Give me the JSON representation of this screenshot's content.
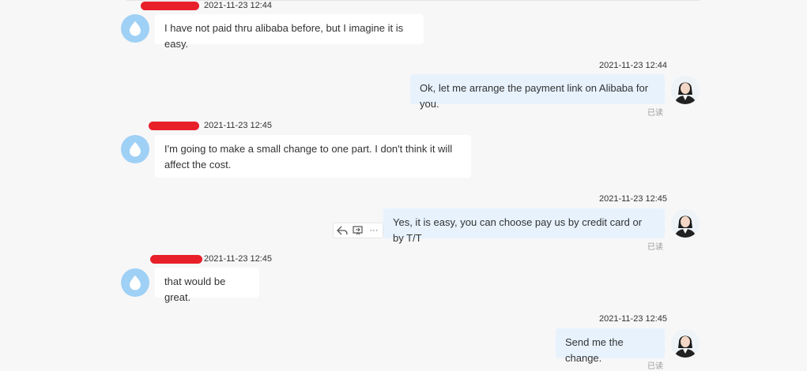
{
  "messages": [
    {
      "side": "left",
      "time": "2021-11-23 12:44",
      "text": "I have not paid thru alibaba before, but I imagine it is easy."
    },
    {
      "side": "right",
      "time": "2021-11-23 12:44",
      "text": "Ok, let me arrange the payment link on Alibaba for you.",
      "status": "已读"
    },
    {
      "side": "left",
      "time": "2021-11-23 12:45",
      "text": "I'm going to make a small change to one part. I don't think it will affect the cost."
    },
    {
      "side": "right",
      "time": "2021-11-23 12:45",
      "text": "Yes, it is easy, you can choose pay us by credit card or by T/T",
      "status": "已读"
    },
    {
      "side": "left",
      "time": "2021-11-23 12:45",
      "text": "that would be great."
    },
    {
      "side": "right",
      "time": "2021-11-23 12:45",
      "text": "Send me the change.",
      "status": "已读"
    }
  ],
  "hover_actions": [
    {
      "name": "reply-icon"
    },
    {
      "name": "forward-icon"
    },
    {
      "name": "more-icon",
      "label": "···"
    }
  ],
  "colors": {
    "background": "#f7f7f8",
    "bubble_left": "#ffffff",
    "bubble_right": "#e7f2fd",
    "avatar_left": "#9fd0f5",
    "redaction": "#e8202a"
  }
}
